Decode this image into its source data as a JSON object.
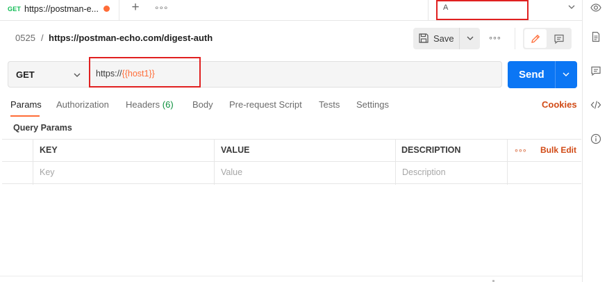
{
  "tab": {
    "method": "GET",
    "title": "https://postman-e..."
  },
  "environment": {
    "value": "A"
  },
  "breadcrumb": {
    "id": "0525",
    "separator": "/",
    "url": "https://postman-echo.com/digest-auth"
  },
  "toolbar": {
    "save_label": "Save"
  },
  "request": {
    "method": "GET",
    "url_prefix": "https://",
    "url_variable": "{{host1}}",
    "send_label": "Send"
  },
  "request_tabs": [
    {
      "label": "Params"
    },
    {
      "label": "Authorization"
    },
    {
      "label": "Headers",
      "count": "(6)"
    },
    {
      "label": "Body"
    },
    {
      "label": "Pre-request Script"
    },
    {
      "label": "Tests"
    },
    {
      "label": "Settings"
    }
  ],
  "cookies_label": "Cookies",
  "query_params": {
    "title": "Query Params",
    "columns": [
      "KEY",
      "VALUE",
      "DESCRIPTION"
    ],
    "placeholders": [
      "Key",
      "Value",
      "Description"
    ],
    "bulk_edit_label": "Bulk Edit"
  },
  "colors": {
    "accent": "#ff6c37",
    "send": "#0b76f4",
    "highlight": "#e02020",
    "method_get": "#0cbb52",
    "link": "#d14a15"
  },
  "icons": {
    "new_tab": "plus-icon",
    "more": "more-horizontal-icon",
    "env": "chevron-down-icon",
    "eye": "eye-icon",
    "docs": "document-icon",
    "comments": "comment-icon",
    "code": "code-icon",
    "info": "info-icon",
    "save": "floppy-disk-icon",
    "edit": "pencil-icon"
  }
}
